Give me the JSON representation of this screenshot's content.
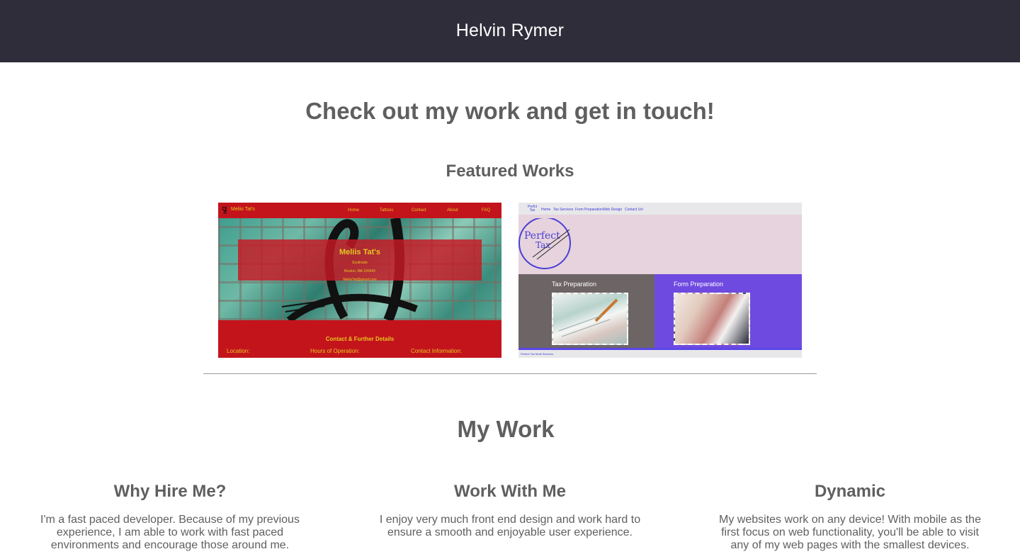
{
  "header": {
    "brand": "Helvin Rymer"
  },
  "hero": {
    "title": "Check out my work and get in touch!"
  },
  "featured": {
    "title": "Featured Works",
    "items": [
      {
        "nav": {
          "name": "Meliis Tat's",
          "links": [
            "Home",
            "Tattoos",
            "Contact",
            "About",
            "FAQ"
          ]
        },
        "banner": {
          "title": "Meliis Tat's",
          "lines": [
            "Southside",
            "Boston, MA 100443",
            "MeliisTat@gmail.com"
          ]
        },
        "contact": {
          "title": "Contact & Further Details",
          "columns": [
            "Location:",
            "Hours of Operation:",
            "Contact Information:"
          ]
        },
        "colors": {
          "primary": "#c3141c",
          "text": "#e6c620"
        }
      },
      {
        "nav": {
          "brand_line1": "Perfct",
          "brand_line2": "Tax",
          "links": [
            "Home",
            "Tax Services",
            "Form Preparation",
            "Web Design",
            "Contact Us!"
          ]
        },
        "logo": {
          "line1": "Perfect",
          "line2": "Tax"
        },
        "cards": [
          {
            "caption": "Tax Preparation"
          },
          {
            "caption": "Form Preparation"
          }
        ],
        "footer": "Perfect Tax Multi-Services",
        "colors": {
          "background": "#e6d3dd",
          "left": "#6d6466",
          "right": "#6f4ae0"
        }
      }
    ]
  },
  "my_work": {
    "title": "My Work",
    "columns": [
      {
        "heading": "Why Hire Me?",
        "text": "I'm a fast paced developer. Because of my previous experience, I am able to work with fast paced environments and encourage those around me."
      },
      {
        "heading": "Work With Me",
        "text": "I enjoy very much front end design and work hard to ensure a smooth and enjoyable user experience."
      },
      {
        "heading": "Dynamic",
        "text": "My websites work on any device! With mobile as the first focus on web functionality, you'll be able to visit any of my web pages with the smallest devices."
      }
    ]
  },
  "colors": {
    "header_bg": "#2f2d3a",
    "text": "#5f5f5f"
  }
}
